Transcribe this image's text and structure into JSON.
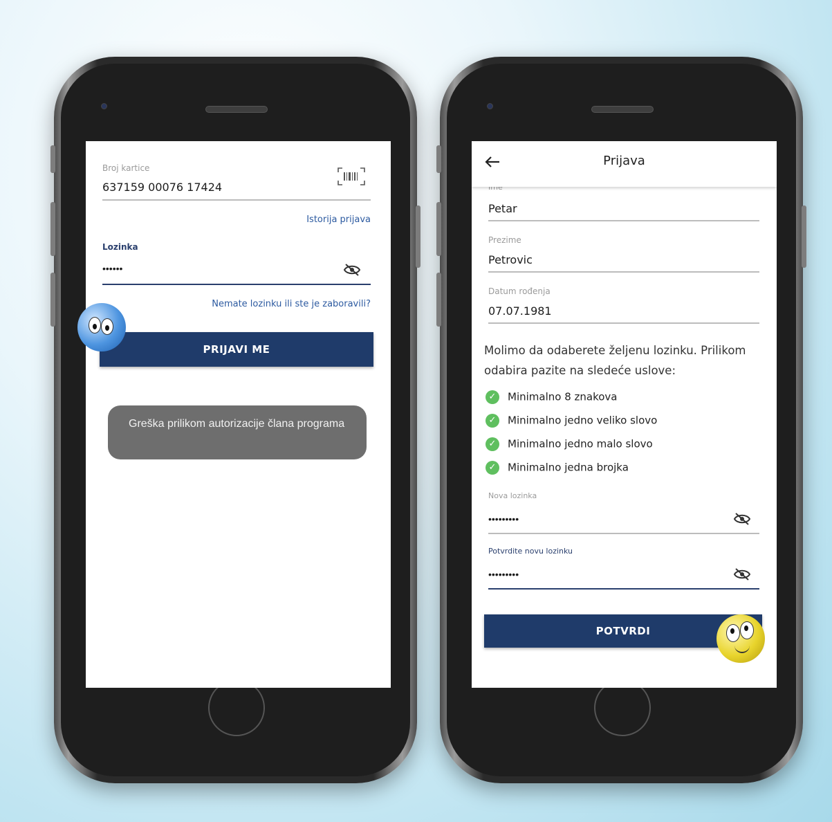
{
  "left_screen": {
    "card_label": "Broj kartice",
    "card_value": "637159 00076 17424",
    "history_link": "Istorija prijava",
    "password_label": "Lozinka",
    "password_value": "••••••",
    "forgot_link": "Nemate lozinku ili ste je zaboravili?",
    "login_button": "PRIJAVI ME",
    "toast": "Greška prilikom autorizacije člana programa"
  },
  "right_screen": {
    "title": "Prijava",
    "first_name_label": "Ime",
    "first_name_value": "Petar",
    "last_name_label": "Prezime",
    "last_name_value": "Petrovic",
    "dob_label": "Datum rođenja",
    "dob_value": "07.07.1981",
    "instructions": "Molimo da odaberete željenu lozinku. Prilikom odabira pazite na sledeće uslove:",
    "rules": [
      "Minimalno 8 znakova",
      "Minimalno jedno veliko slovo",
      "Minimalno jedno malo slovo",
      "Minimalno jedna brojka"
    ],
    "new_password_label": "Nova lozinka",
    "new_password_value": "•••••••••",
    "confirm_password_label": "Potvrdite novu lozinku",
    "confirm_password_value": "•••••••••",
    "confirm_button": "POTVRDI"
  },
  "colors": {
    "accent": "#1f3b6a",
    "link": "#2c5aa0",
    "check": "#5fbf5f",
    "toast_bg": "#6e6e6e"
  },
  "icons": [
    "barcode-icon",
    "eye-off-icon",
    "back-arrow-icon",
    "check-circle-icon"
  ]
}
